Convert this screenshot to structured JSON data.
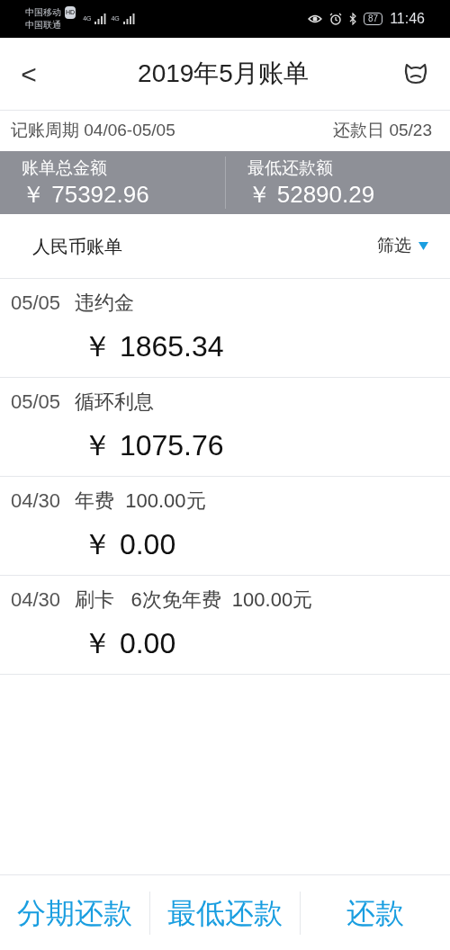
{
  "status_bar": {
    "carrier_1": "中国移动",
    "hd": "HD",
    "network_1": "4G",
    "network_2": "4G",
    "carrier_2": "中国联通",
    "battery": "87",
    "time": "11:46"
  },
  "header": {
    "back": "<",
    "title": "2019年5月账单"
  },
  "period": {
    "label": "记账周期 04/06-05/05",
    "due": "还款日 05/23"
  },
  "summary": [
    {
      "label": "账单总金额",
      "amount": "￥ 75392.96"
    },
    {
      "label": "最低还款额",
      "amount": "￥ 52890.29"
    }
  ],
  "list_header": {
    "title": "人民币账单",
    "filter": "筛选"
  },
  "transactions": [
    {
      "date": "05/05",
      "desc": "违约金",
      "amount": "￥ 1865.34"
    },
    {
      "date": "05/05",
      "desc": "循环利息",
      "amount": "￥ 1075.76"
    },
    {
      "date": "04/30",
      "desc": "年费  100.00元",
      "amount": "￥ 0.00"
    },
    {
      "date": "04/30",
      "desc": "刷卡   6次免年费  100.00元",
      "amount": "￥ 0.00"
    }
  ],
  "actions": [
    "分期还款",
    "最低还款",
    "还款"
  ]
}
